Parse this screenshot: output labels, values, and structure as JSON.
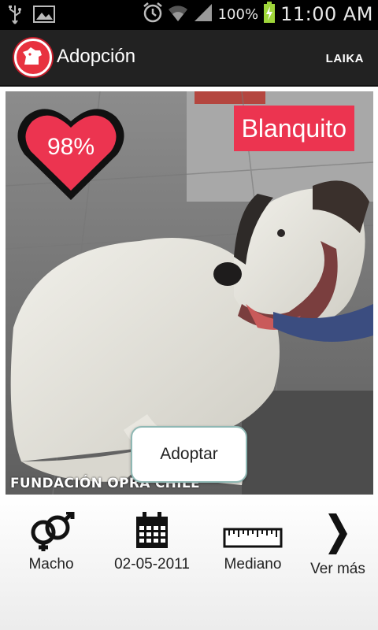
{
  "status_bar": {
    "battery_percent": "100%",
    "time": "11:00 AM",
    "icons": [
      "usb-icon",
      "image-icon",
      "alarm-icon",
      "wifi-icon",
      "signal-icon",
      "battery-charging-icon"
    ]
  },
  "action_bar": {
    "title": "Adopción",
    "right_label": "LAIKA",
    "app_icon": "dog-logo-icon"
  },
  "pet": {
    "name": "Blanquito",
    "match_percent": "98%",
    "foundation": "FUNDACIÓN OPRA CHILE",
    "adopt_label": "Adoptar"
  },
  "info": [
    {
      "icon": "gender-icon",
      "label": "Macho"
    },
    {
      "icon": "calendar-icon",
      "label": "02-05-2011"
    },
    {
      "icon": "ruler-icon",
      "label": "Mediano"
    },
    {
      "icon": "chevron-right-icon",
      "label": "Ver más"
    }
  ],
  "colors": {
    "accent": "#ec3450",
    "action_bar": "#222222",
    "status_bar": "#000000"
  }
}
